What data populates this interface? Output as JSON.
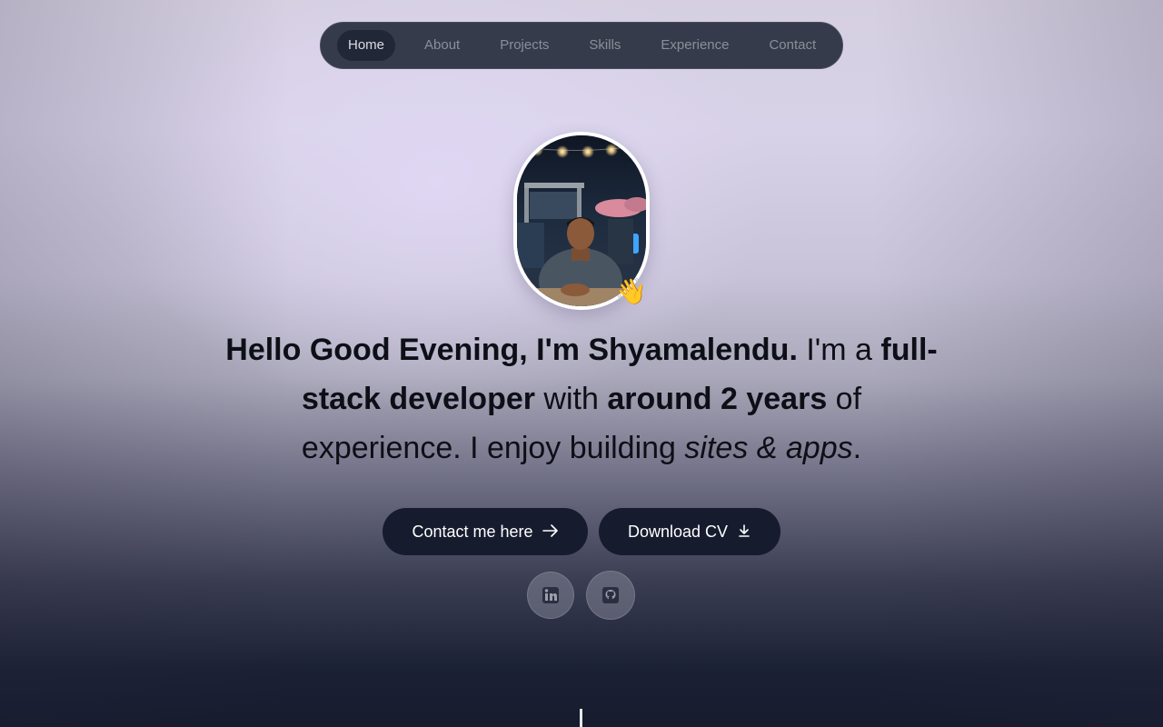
{
  "nav": {
    "items": [
      {
        "label": "Home",
        "active": true
      },
      {
        "label": "About",
        "active": false
      },
      {
        "label": "Projects",
        "active": false
      },
      {
        "label": "Skills",
        "active": false
      },
      {
        "label": "Experience",
        "active": false
      },
      {
        "label": "Contact",
        "active": false
      }
    ]
  },
  "profile": {
    "wave_emoji": "👋"
  },
  "headline": {
    "greeting": "Hello Good Evening, I'm Shyamalendu.",
    "im": " I'm a ",
    "role": "full-stack developer",
    "with": " with ",
    "years": "around 2 years",
    "of_exp": " of experience. I enjoy building ",
    "things": "sites & apps",
    "period": "."
  },
  "buttons": {
    "contact_label": "Contact me here",
    "contact_icon": "arrow-right-icon",
    "cv_label": "Download CV",
    "cv_icon": "download-icon"
  },
  "social": {
    "linkedin_icon": "linkedin-icon",
    "github_icon": "github-icon"
  },
  "colors": {
    "nav_bg": "#363b4b",
    "button_bg": "#161c2e",
    "text_dark": "#0d0f17"
  }
}
